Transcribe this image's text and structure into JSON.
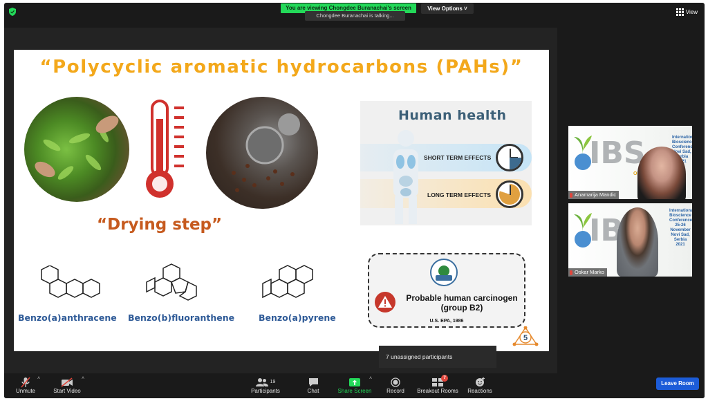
{
  "topbar": {
    "banner": "You are viewing Chongdee Buranachai's screen",
    "view_options": "View Options",
    "talking": "Chongdee Buranachai is talking...",
    "view": "View"
  },
  "slide": {
    "title": "“Polycyclic aromatic hydrocarbons (PAHs)”",
    "drying_step": "“Drying step”",
    "molecules": [
      "Benzo(a)anthracene",
      "Benzo(b)fluoranthene",
      "Benzo(a)pyrene"
    ],
    "health": {
      "title": "Human health",
      "short_term": "SHORT TERM EFFECTS",
      "long_term": "LONG TERM EFFECTS"
    },
    "epa": {
      "classification": "Probable human carcinogen (group B2)",
      "citation": "U.S. EPA, 1986"
    },
    "page_number": "5"
  },
  "unassigned": "7 unassigned participants",
  "participants": [
    {
      "name": "Anamarija Mandic",
      "ibs": "IBS",
      "conf": "International Bioscience Conference",
      "conf_place": "Novi Sad, Serbia",
      "year": "2021",
      "online": "ONL"
    },
    {
      "name": "Oskar Marko",
      "ibs": "IBS",
      "conf": "International Bioscience Conference",
      "conf_dates": "25-26 November",
      "conf_place": "Novi Sad, Serbia",
      "year": "2021"
    }
  ],
  "toolbar": {
    "unmute": "Unmute",
    "start_video": "Start Video",
    "participants": "Participants",
    "participants_count": "19",
    "chat": "Chat",
    "share_screen": "Share Screen",
    "record": "Record",
    "breakout_rooms": "Breakout Rooms",
    "breakout_badge": "7",
    "reactions": "Reactions",
    "leave_room": "Leave Room"
  },
  "colors": {
    "banner_green": "#23d959",
    "title_orange": "#f3a81b",
    "drying_orange": "#c65a1e",
    "molecule_blue": "#2e5a97",
    "leave_blue": "#1c5cd8",
    "share_green": "#23d959"
  }
}
